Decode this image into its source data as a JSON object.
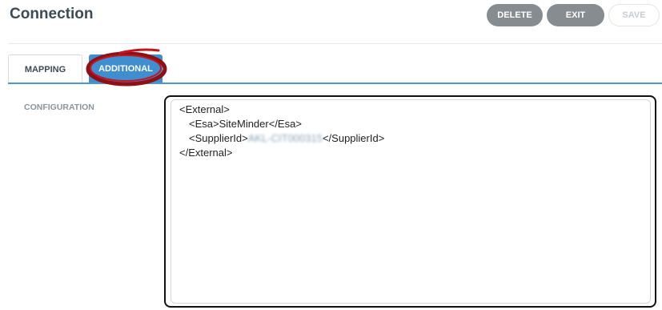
{
  "header": {
    "title": "Connection",
    "buttons": {
      "delete": "DELETE",
      "exit": "EXIT",
      "save": "SAVE"
    }
  },
  "tabs": [
    {
      "label": "MAPPING",
      "active": false
    },
    {
      "label": "ADDITIONAL",
      "active": true
    }
  ],
  "configuration": {
    "label": "CONFIGURATION",
    "lines": {
      "l1": "<External>",
      "l2": "<Esa>SiteMinder</Esa>",
      "l3_open": "<SupplierId>",
      "l3_value": "AKL-CIT000315",
      "l3_close": "</SupplierId>",
      "l4": "</External>"
    }
  },
  "colors": {
    "accent": "#3f8fd0",
    "annotation": "#b3121a",
    "button_gray": "#878c90"
  }
}
